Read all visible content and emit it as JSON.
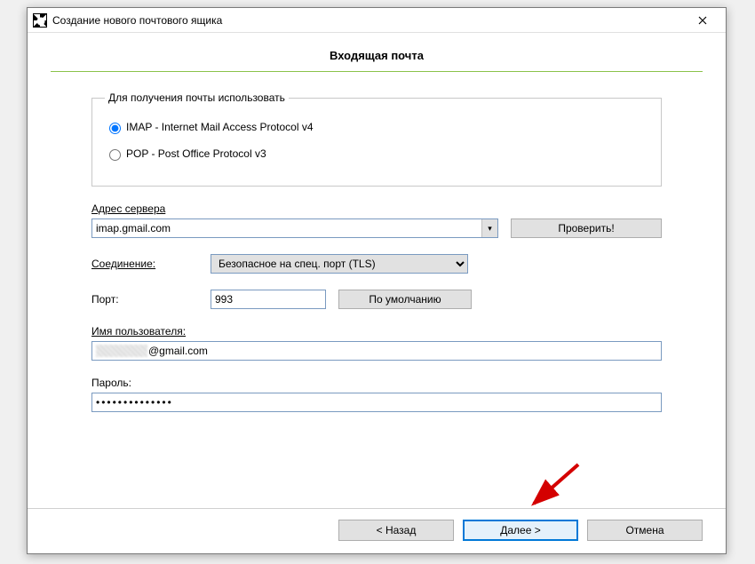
{
  "window": {
    "title": "Создание нового почтового ящика",
    "heading": "Входящая почта"
  },
  "protocol": {
    "legend": "Для получения почты использовать",
    "imap_label": "IMAP - Internet Mail Access Protocol v4",
    "pop_label": "POP  -  Post Office Protocol v3",
    "selected": "imap"
  },
  "server": {
    "label": "Адрес сервера",
    "value": "imap.gmail.com",
    "check_button": "Проверить!"
  },
  "connection": {
    "label": "Соединение:",
    "value": "Безопасное на спец. порт (TLS)"
  },
  "port": {
    "label": "Порт:",
    "value": "993",
    "default_button": "По умолчанию"
  },
  "username": {
    "label": "Имя пользователя:",
    "value_suffix": "@gmail.com"
  },
  "password": {
    "label": "Пароль:",
    "masked": "••••••••••••••"
  },
  "buttons": {
    "back": "<  Назад",
    "next": "Далее  >",
    "cancel": "Отмена"
  }
}
